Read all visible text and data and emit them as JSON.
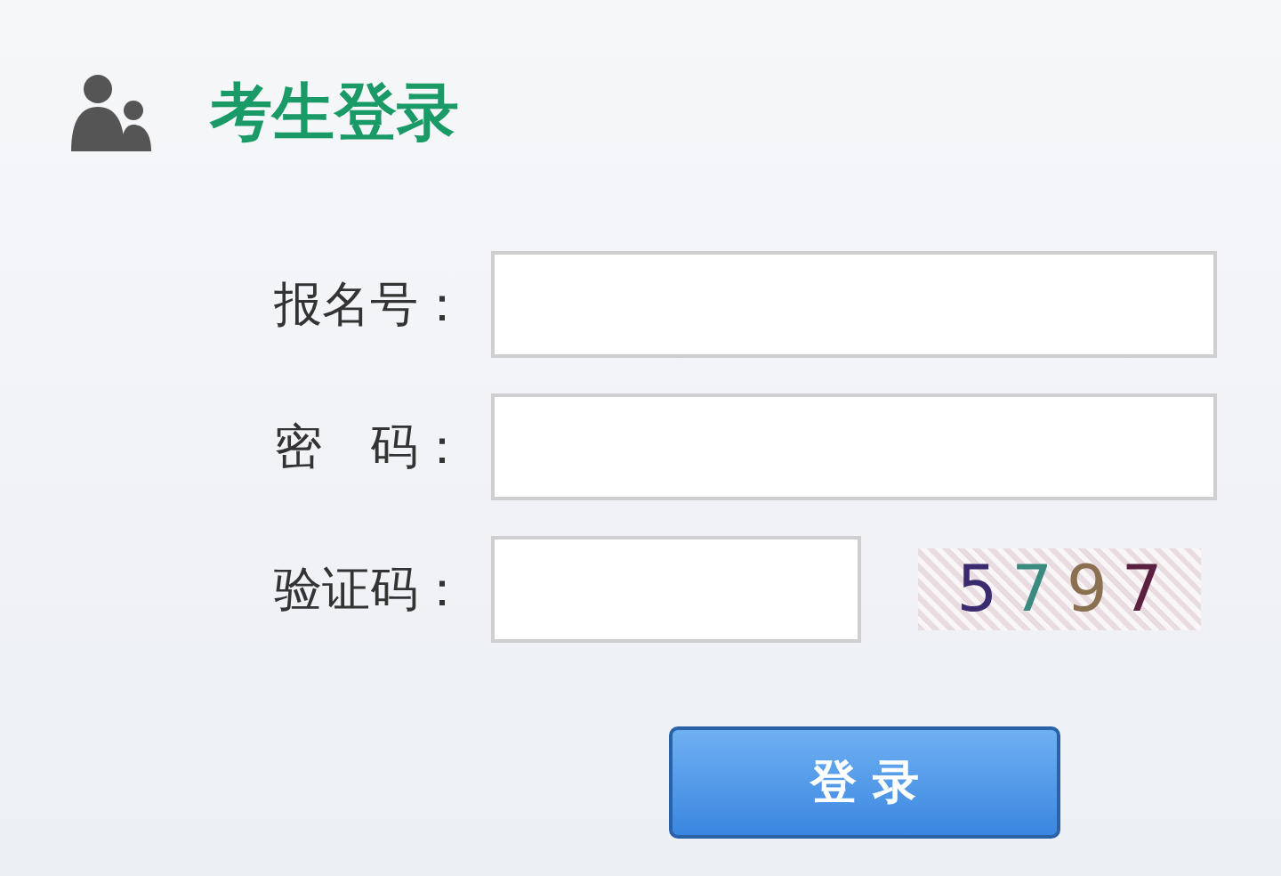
{
  "title": "考生登录",
  "fields": [
    {
      "label": "报名号：",
      "kind": "text"
    },
    {
      "label": "密　码：",
      "kind": "password"
    },
    {
      "label": "验证码：",
      "kind": "captcha",
      "captcha": "5797"
    }
  ],
  "button": "登 录"
}
